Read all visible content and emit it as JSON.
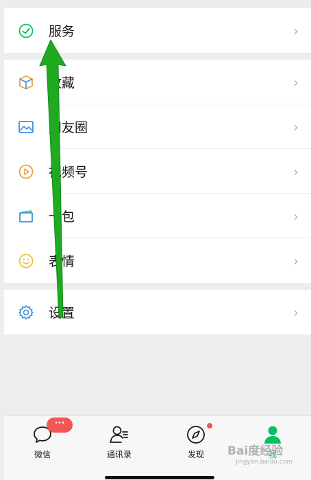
{
  "menu": {
    "service": {
      "label": "服务",
      "icon": "service-icon"
    },
    "items": [
      {
        "label": "收藏",
        "icon": "favorites-cube-icon"
      },
      {
        "label": "朋友圈",
        "icon": "moments-picture-icon"
      },
      {
        "label": "视频号",
        "icon": "channels-play-icon"
      },
      {
        "label": "卡包",
        "icon": "card-wallet-icon"
      },
      {
        "label": "表情",
        "icon": "sticker-smile-icon"
      }
    ],
    "settings": {
      "label": "设置",
      "icon": "gear-icon"
    },
    "chevron": "›"
  },
  "tabbar": {
    "tabs": [
      {
        "label": "微信",
        "icon": "chat-bubble-icon",
        "badge": "···"
      },
      {
        "label": "通讯录",
        "icon": "contacts-icon"
      },
      {
        "label": "发现",
        "icon": "compass-icon"
      },
      {
        "label": "我",
        "icon": "person-icon",
        "active": true
      }
    ]
  },
  "watermark": {
    "text": "Bai度经验",
    "sub": "jingyan.baidu.com"
  },
  "colors": {
    "accent_green": "#07c160",
    "annotation_arrow": "#1faa22",
    "badge_red": "#f25555",
    "service_icon": "#07c160",
    "favorites_icon": "#e9a23b",
    "moments_icon": "#3b8fe0",
    "channels_icon": "#e9a23b",
    "card_icon": "#3b8fe0",
    "sticker_icon": "#f2c230",
    "settings_icon": "#3b8fe0"
  }
}
